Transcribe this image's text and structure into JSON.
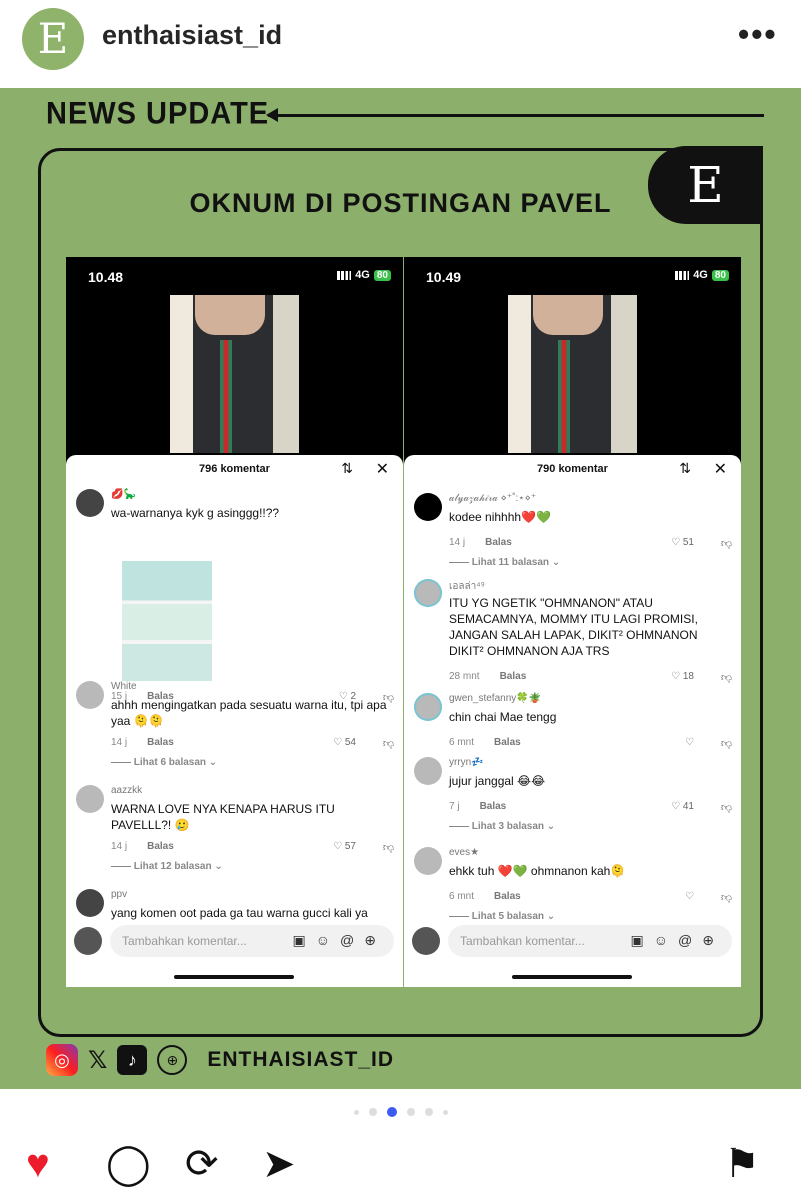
{
  "header": {
    "avatar_letter": "E",
    "username": "enthaisiast_id",
    "more_label": "•••"
  },
  "post": {
    "news_label": "NEWS UPDATE",
    "corner_logo": "E",
    "headline": "OKNUM DI POSTINGAN PAVEL",
    "left_screen": {
      "time": "10.48",
      "network": "4G",
      "battery": "80",
      "count": "796 komentar",
      "comments": [
        {
          "user": "💋🦕",
          "text": "wa-warnanya kyk g asinggg!!??",
          "time": "15 j",
          "reply": "Balas",
          "likes": "2"
        },
        {
          "user": "White",
          "text": "ahhh mengingatkan pada sesuatu warna itu, tpi apa yaa 🫠🫠",
          "time": "14 j",
          "reply": "Balas",
          "likes": "54",
          "more": "Lihat 6 balasan"
        },
        {
          "user": "aazzkk",
          "text": "WARNA LOVE NYA KENAPA HARUS ITU PAVELLL?! 🥲",
          "time": "14 j",
          "reply": "Balas",
          "likes": "57",
          "more": "Lihat 12 balasan"
        },
        {
          "user": "ppv",
          "text": "yang komen oot pada ga tau warna gucci kali ya"
        }
      ],
      "input_placeholder": "Tambahkan komentar..."
    },
    "right_screen": {
      "time": "10.49",
      "network": "4G",
      "battery": "80",
      "count": "790 komentar",
      "comments": [
        {
          "user": "𝒶𝓁𝓎𝒶𝓏𝒶𝒽𝒾𝓇𝒶 ⋄⁺˚:⋆⋄⁺",
          "text": "kodee nihhhh❤️💚",
          "time": "14 j",
          "reply": "Balas",
          "likes": "51",
          "more": "Lihat 11 balasan"
        },
        {
          "user": "เอลล่า⁴⁹",
          "text": "ITU YG NGETIK \"OHMNANON\" ATAU SEMACAMNYA, MOMMY ITU LAGI PROMISI, JANGAN SALAH LAPAK, DIKIT² OHMNANON DIKIT² OHMNANON AJA TRS",
          "time": "28 mnt",
          "reply": "Balas",
          "likes": "18"
        },
        {
          "user": "gwen_stefanny🍀🪴",
          "text": "chin chai Mae tengg",
          "time": "6 mnt",
          "reply": "Balas",
          "likes": ""
        },
        {
          "user": "yrryn💤",
          "text": "jujur janggal 😂😂",
          "time": "7 j",
          "reply": "Balas",
          "likes": "41",
          "more": "Lihat 3 balasan"
        },
        {
          "user": "eves★",
          "text": "ehkk tuh ❤️💚 ohmnanon kah🫠",
          "time": "6 mnt",
          "reply": "Balas",
          "likes": "",
          "more": "Lihat 5 balasan"
        }
      ],
      "input_placeholder": "Tambahkan komentar..."
    },
    "social_handle": "ENTHAISIAST_ID"
  },
  "icons": [
    "more-icon",
    "sort-icon",
    "close-icon",
    "heart-outline-icon",
    "dislike-icon",
    "image-icon",
    "emoji-icon",
    "mention-icon",
    "gift-icon",
    "instagram-icon",
    "x-icon",
    "tiktok-icon",
    "globe-icon",
    "heart-icon",
    "comment-icon",
    "repost-icon",
    "share-icon",
    "bookmark-icon"
  ],
  "carousel": {
    "total": 6,
    "active": 2
  }
}
